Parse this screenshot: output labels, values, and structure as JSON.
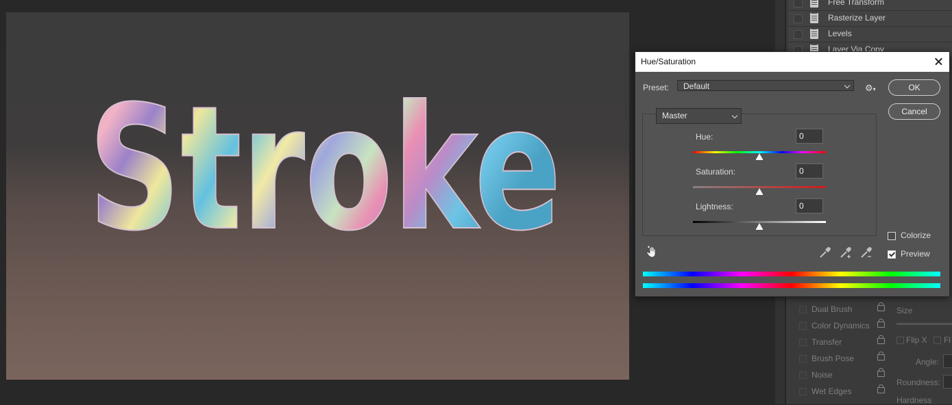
{
  "history": {
    "items": [
      {
        "label": "Free Transform"
      },
      {
        "label": "Rasterize Layer"
      },
      {
        "label": "Levels"
      },
      {
        "label": "Layer Via Copy"
      }
    ]
  },
  "canvas": {
    "text": "Stroke"
  },
  "dialog": {
    "title": "Hue/Saturation",
    "preset_label": "Preset:",
    "preset_value": "Default",
    "channel_value": "Master",
    "hue": {
      "label": "Hue:",
      "value": "0"
    },
    "saturation": {
      "label": "Saturation:",
      "value": "0"
    },
    "lightness": {
      "label": "Lightness:",
      "value": "0"
    },
    "ok_label": "OK",
    "cancel_label": "Cancel",
    "colorize_label": "Colorize",
    "colorize_checked": false,
    "preview_label": "Preview",
    "preview_checked": true
  },
  "brush_settings": {
    "items": [
      {
        "label": "Dual Brush"
      },
      {
        "label": "Color Dynamics"
      },
      {
        "label": "Transfer"
      },
      {
        "label": "Brush Pose"
      },
      {
        "label": "Noise"
      },
      {
        "label": "Wet Edges"
      }
    ],
    "size_label": "Size",
    "flip_x_label": "Flip X",
    "flip_y_label": "Fl",
    "angle_label": "Angle:",
    "roundness_label": "Roundness:",
    "hardness_label": "Hardness"
  },
  "colors": {
    "canvas_top": "#3c3c3c",
    "canvas_bottom": "#7a655d",
    "pastel_pink": "#e98fb3",
    "pastel_yellow": "#efe79c",
    "pastel_blue": "#63c1e0",
    "pastel_purple": "#9b82c8"
  }
}
